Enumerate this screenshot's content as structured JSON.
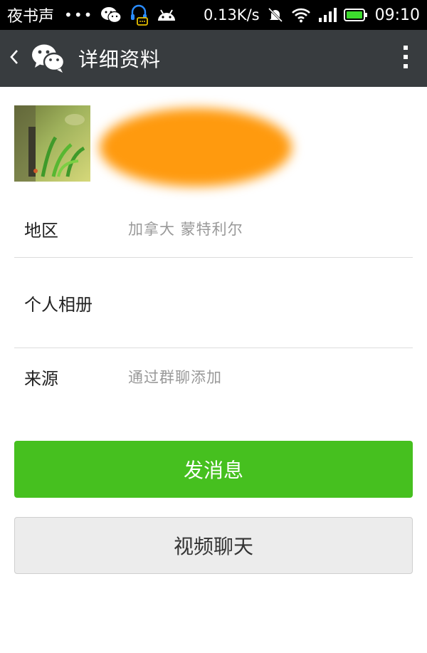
{
  "status_bar": {
    "carrier": "夜书声",
    "dots": "•••",
    "speed": "0.13K/s",
    "time": "09:10"
  },
  "header": {
    "title": "详细资料"
  },
  "profile": {
    "rows": [
      {
        "label": "地区",
        "value": "加拿大  蒙特利尔"
      },
      {
        "label": "个人相册",
        "value": ""
      },
      {
        "label": "来源",
        "value": "通过群聊添加"
      }
    ]
  },
  "actions": {
    "send_message": "发消息",
    "video_chat": "视频聊天"
  },
  "colors": {
    "primary_green": "#46c01f",
    "titlebar": "#383c3f",
    "redaction": "#ff9a0e"
  }
}
